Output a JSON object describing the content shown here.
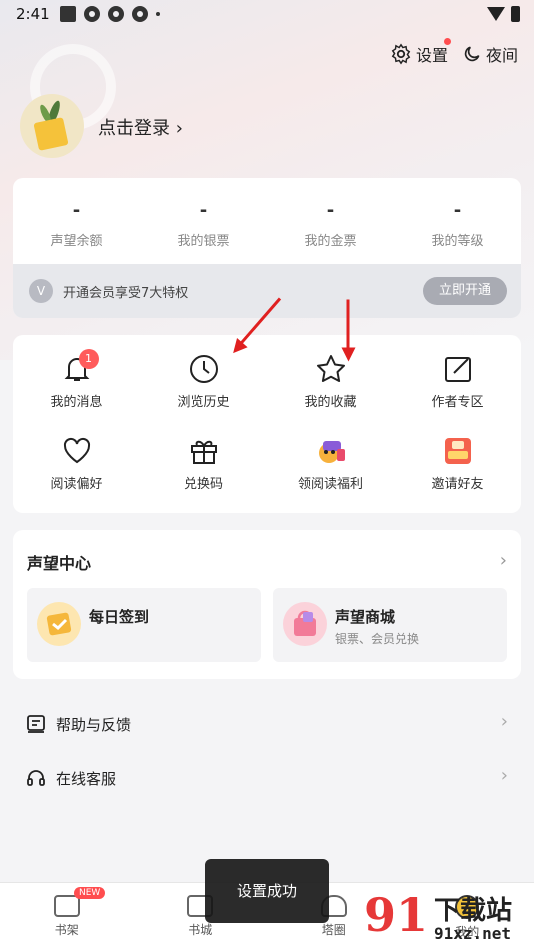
{
  "status_bar": {
    "time": "2:41"
  },
  "top_links": {
    "settings": "设置",
    "night": "夜间"
  },
  "login": {
    "label": "点击登录 ›"
  },
  "stats": [
    {
      "value": "-",
      "label": "声望余额"
    },
    {
      "value": "-",
      "label": "我的银票"
    },
    {
      "value": "-",
      "label": "我的金票"
    },
    {
      "value": "-",
      "label": "我的等级"
    }
  ],
  "vip": {
    "text": "开通会员享受7大特权",
    "button": "立即开通",
    "icon": "V"
  },
  "grid": [
    {
      "label": "我的消息",
      "icon": "bell-icon",
      "badge": "1"
    },
    {
      "label": "浏览历史",
      "icon": "clock-icon"
    },
    {
      "label": "我的收藏",
      "icon": "star-icon"
    },
    {
      "label": "作者专区",
      "icon": "edit-icon"
    },
    {
      "label": "阅读偏好",
      "icon": "heart-icon"
    },
    {
      "label": "兑换码",
      "icon": "gift-icon"
    },
    {
      "label": "领阅读福利",
      "icon": "reward-icon"
    },
    {
      "label": "邀请好友",
      "icon": "invite-icon"
    }
  ],
  "prestige": {
    "title": "声望中心",
    "chevron": "›",
    "checkin": {
      "title": "每日签到"
    },
    "store": {
      "title": "声望商城",
      "desc": "银票、会员兑换"
    }
  },
  "list": [
    {
      "label": "帮助与反馈",
      "icon": "feedback-icon"
    },
    {
      "label": "在线客服",
      "icon": "headset-icon"
    }
  ],
  "bottom_nav": [
    {
      "label": "书架",
      "badge": "NEW"
    },
    {
      "label": "书城"
    },
    {
      "label": "塔圈"
    },
    {
      "label": "我的"
    }
  ],
  "toast": "设置成功",
  "watermark": {
    "big": "91",
    "cn": "下载站",
    "url": "91xz.net"
  },
  "colors": {
    "accent_red": "#ff4d4f",
    "arrow_red": "#e02020",
    "card_bg": "#ffffff",
    "page_bg": "#f4f4f6"
  }
}
